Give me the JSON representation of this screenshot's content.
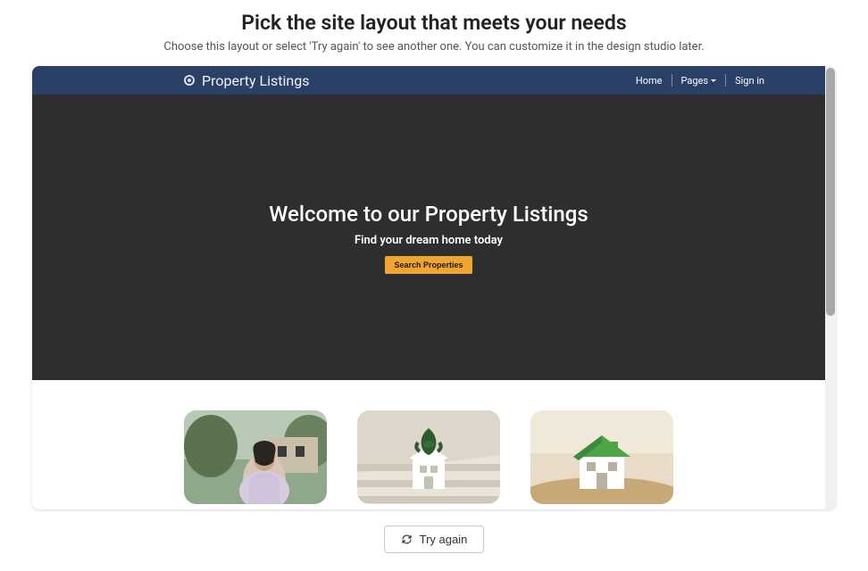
{
  "header": {
    "title": "Pick the site layout that meets your needs",
    "subtitle": "Choose this layout or select 'Try again' to see another one. You can customize it in the design studio later."
  },
  "preview": {
    "navbar": {
      "brand": "Property Listings",
      "links": {
        "home": "Home",
        "pages": "Pages",
        "signin": "Sign in"
      }
    },
    "hero": {
      "title": "Welcome to our Property Listings",
      "subtitle": "Find your dream home today",
      "button": "Search Properties"
    }
  },
  "actions": {
    "try_again": "Try again"
  }
}
